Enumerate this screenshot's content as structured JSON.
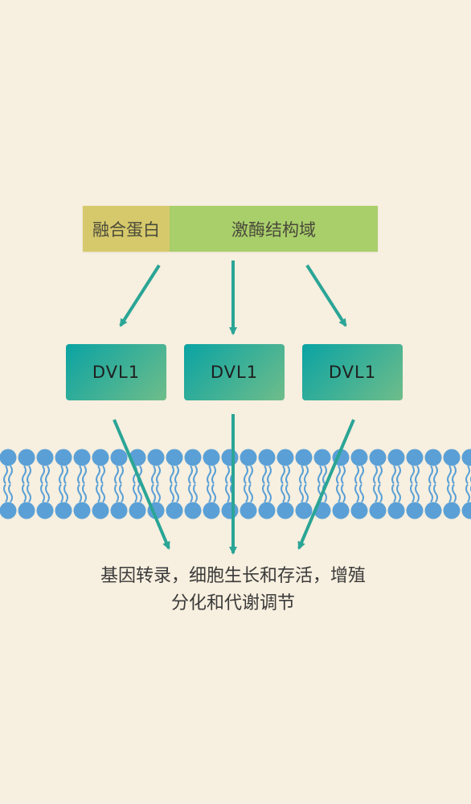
{
  "fusion_bar": {
    "fusion_label": "融合蛋白",
    "kinase_label": "激酶结构域",
    "fusion_color": "#d6c96b",
    "kinase_color": "#a9cf6b"
  },
  "dvl_boxes": [
    {
      "label": "DVL1"
    },
    {
      "label": "DVL1"
    },
    {
      "label": "DVL1"
    }
  ],
  "outcome": {
    "line1": "基因转录，细胞生长和存活，增殖",
    "line2": "分化和代谢调节"
  },
  "colors": {
    "background": "#f7efdf",
    "arrow": "#2aa596",
    "membrane": "#5aa0d6",
    "dvl_gradient_start": "#0aa3a3",
    "dvl_gradient_end": "#6fbd8a"
  }
}
